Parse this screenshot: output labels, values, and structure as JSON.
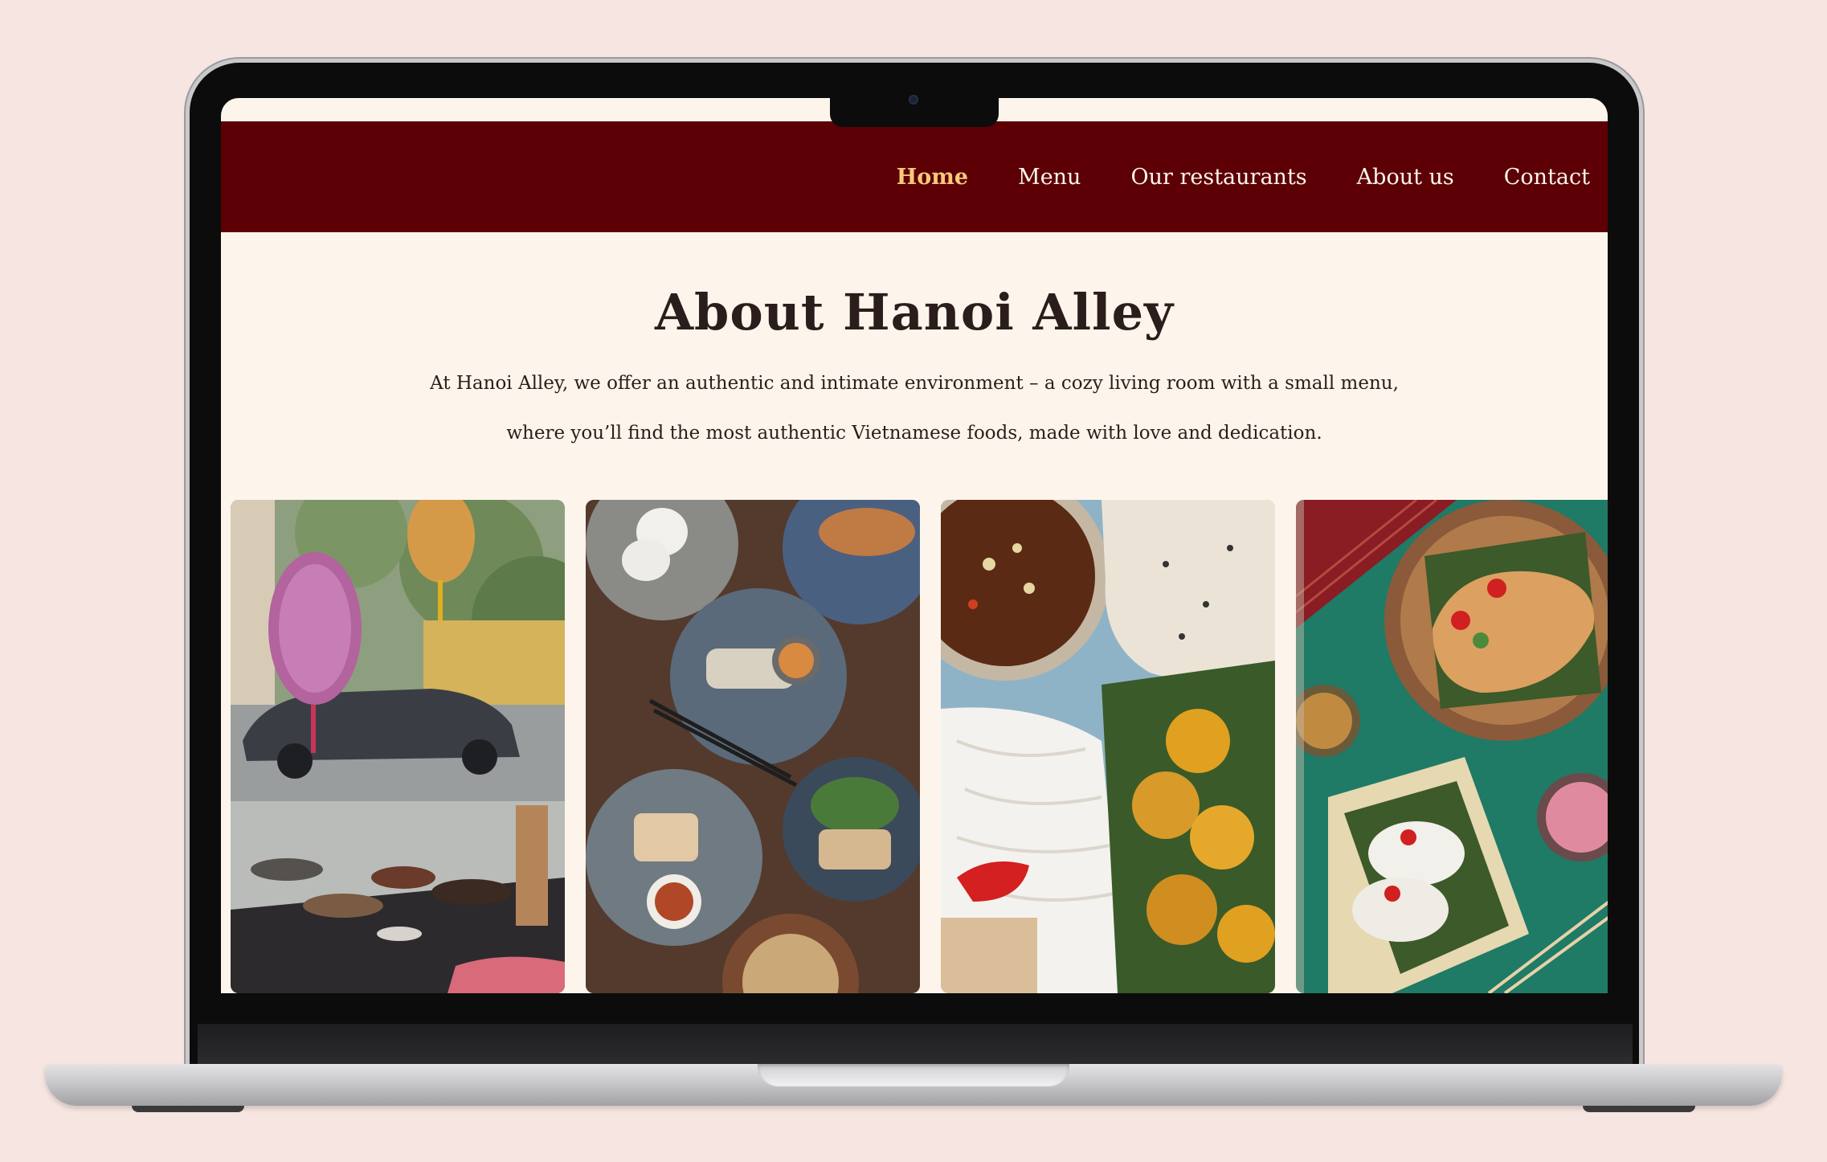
{
  "nav": {
    "items": [
      {
        "label": "Home",
        "active": true
      },
      {
        "label": "Menu",
        "active": false
      },
      {
        "label": "Our restaurants",
        "active": false
      },
      {
        "label": "About us",
        "active": false
      },
      {
        "label": "Contact",
        "active": false
      }
    ]
  },
  "about": {
    "title": "About Hanoi Alley",
    "paragraph_line_1": "At Hanoi Alley, we offer an authentic and intimate environment – a cozy living room with a small menu,",
    "paragraph_line_2": "where you’ll find the most authentic Vietnamese foods, made with love and dedication."
  },
  "colors": {
    "page_background": "#f6e5e0",
    "site_background": "#fdf5ec",
    "navbar": "#5c0006",
    "nav_active": "#f7c97c",
    "text": "#2b1d1b"
  },
  "gallery": {
    "photos": [
      {
        "subject": "restaurant-window-lanterns"
      },
      {
        "subject": "dishes-on-wooden-table"
      },
      {
        "subject": "rice-noodles-and-dipping-sauce"
      },
      {
        "subject": "banh-mi-and-bao-on-green-table"
      }
    ]
  }
}
